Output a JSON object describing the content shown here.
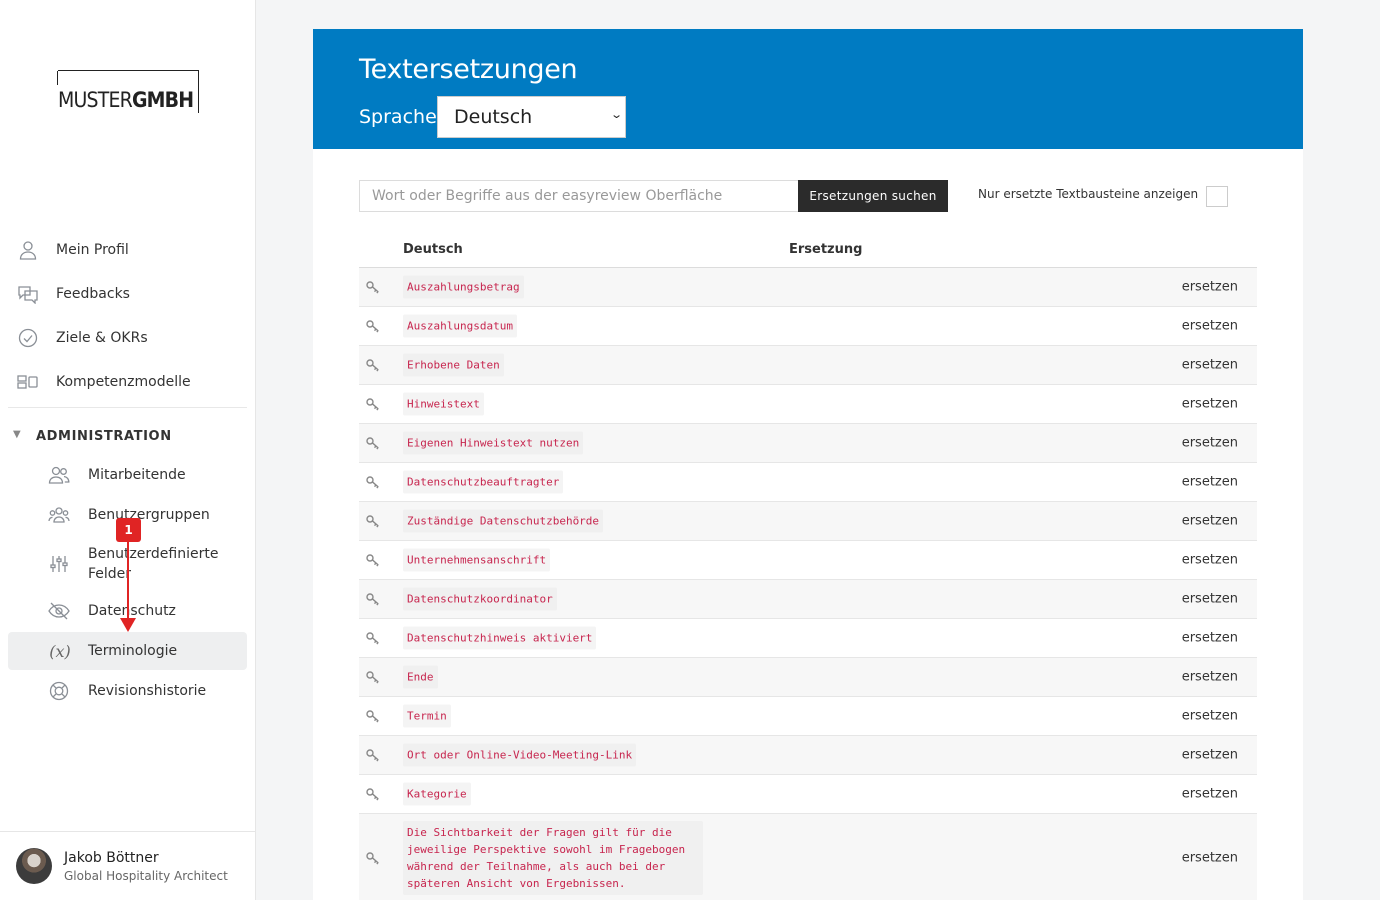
{
  "logo": {
    "regular": "MUSTER",
    "bold": "GMBH"
  },
  "nav": {
    "top": [
      {
        "label": "Mein Profil",
        "icon": "user-icon"
      },
      {
        "label": "Feedbacks",
        "icon": "chat-icon"
      },
      {
        "label": "Ziele & OKRs",
        "icon": "check-circle-icon"
      },
      {
        "label": "Kompetenzmodelle",
        "icon": "blocks-icon"
      }
    ],
    "section_title": "ADMINISTRATION",
    "admin": [
      {
        "label": "Mitarbeitende",
        "icon": "users-icon"
      },
      {
        "label": "Benutzergruppen",
        "icon": "group-icon"
      },
      {
        "label": "Benutzerdefinierte Felder",
        "icon": "sliders-icon"
      },
      {
        "label": "Datenschutz",
        "icon": "eye-off-icon"
      },
      {
        "label": "Terminologie",
        "icon": "variable-icon"
      },
      {
        "label": "Revisionshistorie",
        "icon": "lifebuoy-icon"
      }
    ]
  },
  "annotation": {
    "badge": "1",
    "color": "#e02424"
  },
  "user": {
    "name": "Jakob Böttner",
    "role": "Global Hospitality Architect"
  },
  "header": {
    "title": "Textersetzungen",
    "language_label": "Sprache:",
    "language_value": "Deutsch",
    "color": "#007bc2"
  },
  "search": {
    "placeholder": "Wort oder Begriffe aus der easyreview Oberfläche",
    "button": "Ersetzungen suchen",
    "only_replaced_label": "Nur ersetzte Textbausteine anzeigen"
  },
  "table": {
    "col_german": "Deutsch",
    "col_replacement": "Ersetzung",
    "action_label": "ersetzen",
    "rows": [
      "Auszahlungsbetrag",
      "Auszahlungsdatum",
      "Erhobene Daten",
      "Hinweistext",
      "Eigenen Hinweistext nutzen",
      "Datenschutzbeauftragter",
      "Zuständige Datenschutzbehörde",
      "Unternehmensanschrift",
      "Datenschutzkoordinator",
      "Datenschutzhinweis aktiviert",
      "Ende",
      "Termin",
      "Ort oder Online-Video-Meeting-Link",
      "Kategorie",
      "Die Sichtbarkeit der Fragen gilt für die jeweilige Perspektive sowohl im Fragebogen während der Teilnahme, als auch bei der späteren Ansicht von Ergebnissen."
    ]
  }
}
